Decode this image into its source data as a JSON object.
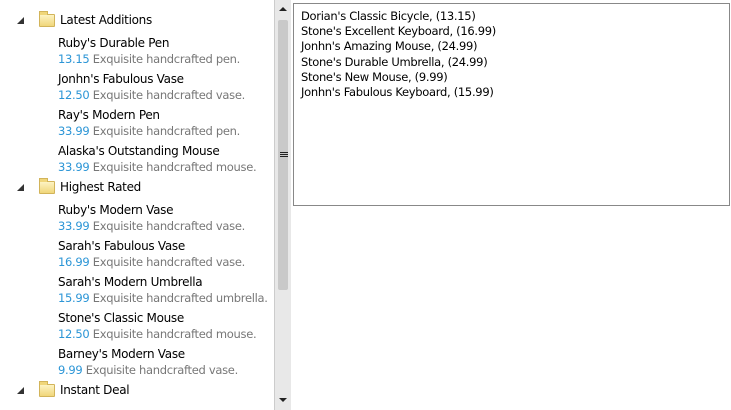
{
  "groups": [
    {
      "title": "Latest Additions",
      "items": [
        {
          "name": "Ruby's Durable Pen",
          "price": "13.15",
          "desc": "Exquisite handcrafted pen."
        },
        {
          "name": "Jonhn's Fabulous Vase",
          "price": "12.50",
          "desc": "Exquisite handcrafted vase."
        },
        {
          "name": "Ray's Modern Pen",
          "price": "33.99",
          "desc": "Exquisite handcrafted pen."
        },
        {
          "name": "Alaska's Outstanding Mouse",
          "price": "33.99",
          "desc": "Exquisite handcrafted mouse."
        }
      ]
    },
    {
      "title": "Highest Rated",
      "items": [
        {
          "name": "Ruby's Modern Vase",
          "price": "33.99",
          "desc": "Exquisite handcrafted vase."
        },
        {
          "name": "Sarah's Fabulous Vase",
          "price": "16.99",
          "desc": "Exquisite handcrafted vase."
        },
        {
          "name": "Sarah's Modern Umbrella",
          "price": "15.99",
          "desc": "Exquisite handcrafted umbrella."
        },
        {
          "name": "Stone's Classic Mouse",
          "price": "12.50",
          "desc": "Exquisite handcrafted mouse."
        },
        {
          "name": "Barney's Modern Vase",
          "price": "9.99",
          "desc": "Exquisite handcrafted vase."
        }
      ]
    },
    {
      "title": "Instant Deal",
      "items": []
    }
  ],
  "list": [
    "Dorian's Classic Bicycle, (13.15)",
    "Stone's Excellent Keyboard, (16.99)",
    "Jonhn's Amazing Mouse, (24.99)",
    "Stone's Durable Umbrella, (24.99)",
    "Stone's New Mouse, (9.99)",
    "Jonhn's Fabulous Keyboard, (15.99)"
  ],
  "colors": {
    "price": "#2b95d6",
    "desc": "#777777"
  }
}
